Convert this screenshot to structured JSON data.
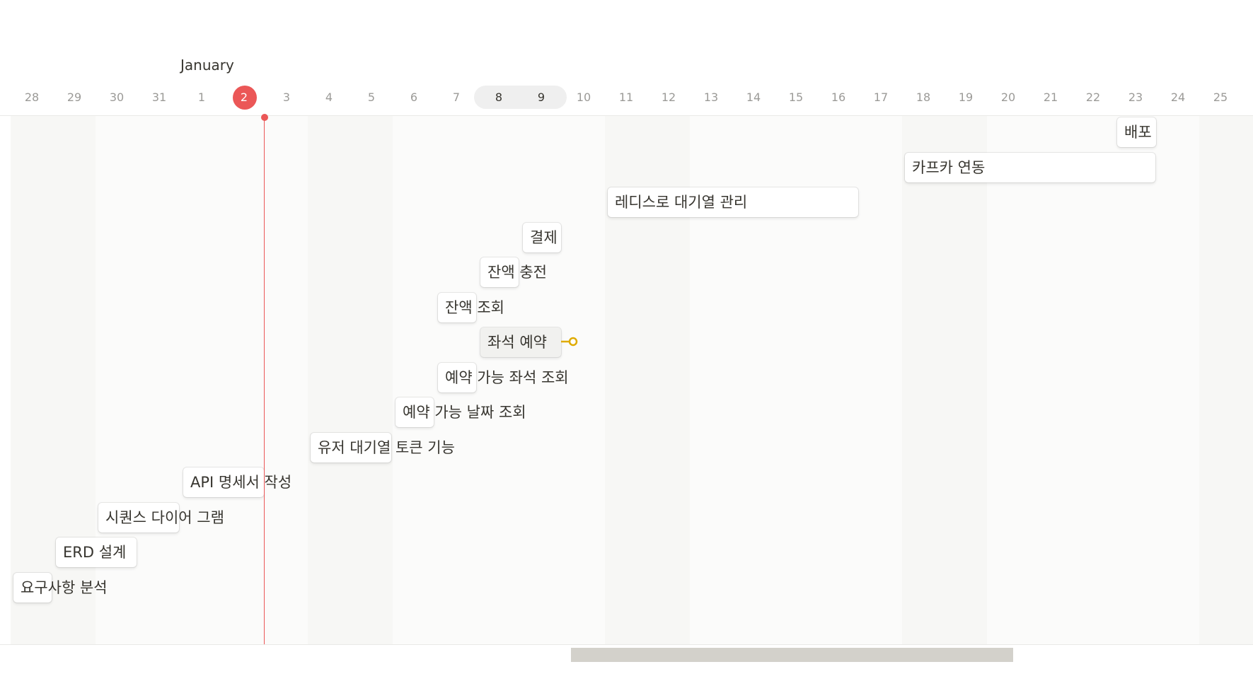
{
  "calendar": {
    "month": "January",
    "days": [
      "28",
      "29",
      "30",
      "31",
      "1",
      "2",
      "3",
      "4",
      "5",
      "6",
      "7",
      "8",
      "9",
      "10",
      "11",
      "12",
      "13",
      "14",
      "15",
      "16",
      "17",
      "18",
      "19",
      "20",
      "21",
      "22",
      "23",
      "24",
      "25"
    ],
    "today": "2",
    "selected_days": [
      "8",
      "9"
    ]
  },
  "tasks": [
    {
      "label": "배포"
    },
    {
      "label": "카프카 연동"
    },
    {
      "label": "레디스로 대기열 관리"
    },
    {
      "label": "결제"
    },
    {
      "label": "잔액 충전"
    },
    {
      "label": "잔액 조회"
    },
    {
      "label": "좌석 예약"
    },
    {
      "label": "예약 가능 좌석 조회"
    },
    {
      "label": "예약 가능 날짜 조회"
    },
    {
      "label": "유저 대기열 토큰 기능"
    },
    {
      "label": "API 명세서 작성"
    },
    {
      "label": "시퀀스 다이어 그램"
    },
    {
      "label": "ERD 설계"
    },
    {
      "label": "요구사항 분석"
    }
  ],
  "colors": {
    "today": "#eb5757",
    "connector": "#dfab01",
    "scrollbar_thumb": "#d3d1cb"
  }
}
